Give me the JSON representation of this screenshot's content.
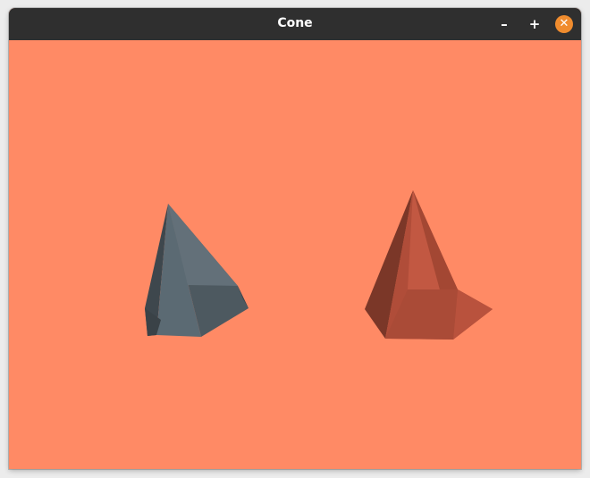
{
  "window": {
    "title": "Cone",
    "minimize_glyph": "–",
    "maximize_glyph": "+",
    "close_glyph": "✕"
  },
  "scene": {
    "background_color": "#ff8a65",
    "cones": [
      {
        "name": "gray-cone",
        "color": "#56636b"
      },
      {
        "name": "red-cone",
        "color": "#b9513b"
      }
    ]
  }
}
